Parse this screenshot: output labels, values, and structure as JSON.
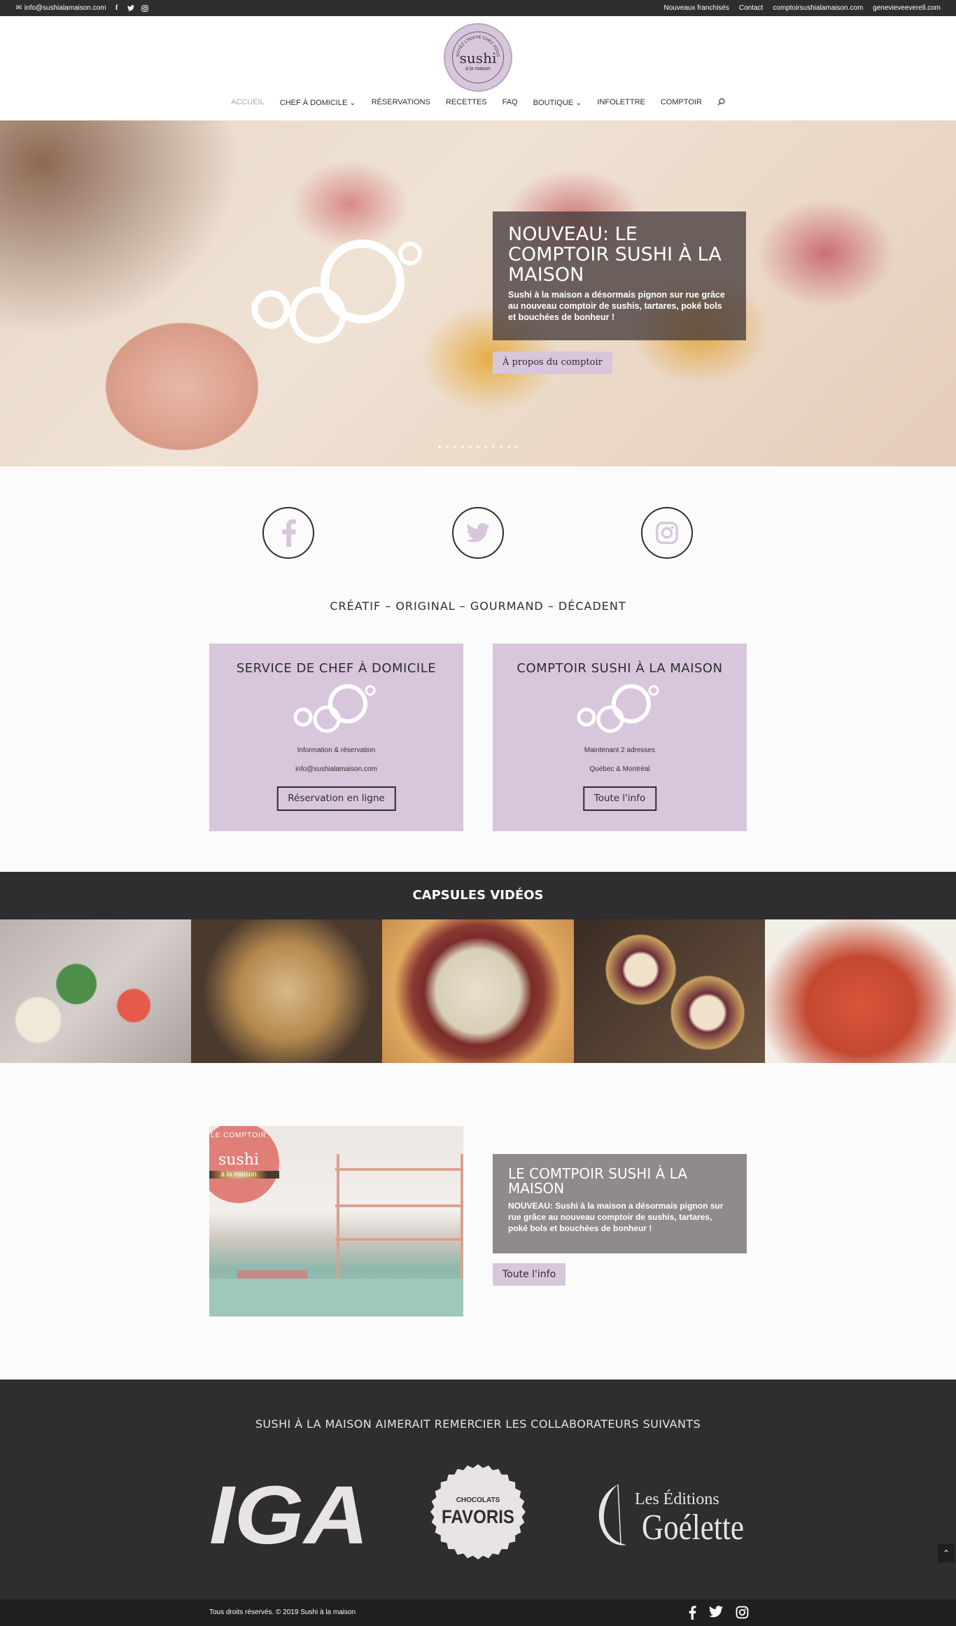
{
  "topbar": {
    "email": "info@sushialamaison.com",
    "links": [
      "Nouveaux franchisés",
      "Contact",
      "comptoirsushialamaison.com",
      "genevieveeverell.com"
    ]
  },
  "logo": {
    "arc_text": "SOYEZ L'INVITÉ CHEZ VOUS",
    "word": "sushi",
    "sub": "à la maison"
  },
  "nav": {
    "items": [
      "ACCUEIL",
      "CHEF À DOMICILE",
      "RÉSERVATIONS",
      "RECETTES",
      "FAQ",
      "BOUTIQUE",
      "INFOLETTRE",
      "COMPTOIR"
    ],
    "active_index": 0
  },
  "hero": {
    "title": "NOUVEAU: LE COMPTOIR SUSHI À LA MAISON",
    "text": "Sushi à la maison a désormais pignon sur rue grâce au nouveau comptoir de sushis, tartares, poké bols et bouchées de bonheur !",
    "button": "À propos du comptoir",
    "slides": 11,
    "active_slide": 0
  },
  "tagline": "CRÉATIF – ORIGINAL – GOURMAND – DÉCADENT",
  "cards": [
    {
      "title": "SERVICE DE CHEF À DOMICILE",
      "line1": "Information & réservation",
      "line2": "info@sushialamaison.com",
      "button": "Réservation en ligne"
    },
    {
      "title": "COMPTOIR SUSHI À LA MAISON",
      "line1": "Maintenant 2 adresses",
      "line2": "Québec & Montréal",
      "button": "Toute l'info"
    }
  ],
  "videos": {
    "title": "CAPSULES VIDÉOS"
  },
  "comptoir": {
    "badge_top": "LE COMPTOIR",
    "badge_word": "sushi",
    "badge_sub": "à la maison",
    "title": "LE COMTPOIR SUSHI À LA MAISON",
    "text": "NOUVEAU: Sushi à la maison a désormais pignon sur rue grâce au nouveau comptoir de sushis, tartares, poké bols et bouchées de bonheur !",
    "button": "Toute l'info"
  },
  "partners": {
    "title": "SUSHI À LA MAISON AIMERAIT REMERCIER LES COLLABORATEURS SUIVANTS",
    "iga": "IGA",
    "choco_top": "CHOCOLATS",
    "choco_main": "FAVORIS",
    "goelette_top": "Les Éditions",
    "goelette_main": "Goélette"
  },
  "footer": {
    "copyright": "Tous droits réservés. © 2019 Sushi à la maison"
  },
  "colors": {
    "lavender": "#d7c6dc",
    "dark": "#2e2d30"
  }
}
